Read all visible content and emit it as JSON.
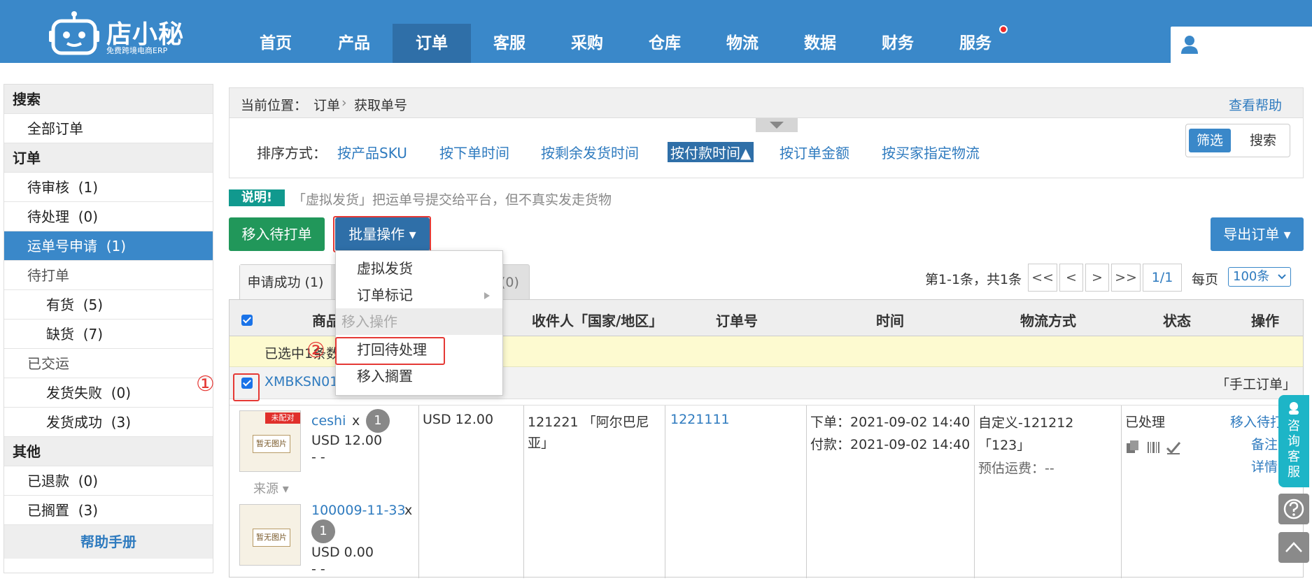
{
  "brand": {
    "name": "店小秘",
    "tagline": "免费跨境电商ERP"
  },
  "nav": {
    "items": [
      {
        "label": "首页"
      },
      {
        "label": "产品"
      },
      {
        "label": "订单"
      },
      {
        "label": "客服"
      },
      {
        "label": "采购"
      },
      {
        "label": "仓库"
      },
      {
        "label": "物流"
      },
      {
        "label": "数据"
      },
      {
        "label": "财务"
      },
      {
        "label": "服务"
      }
    ],
    "active": "订单"
  },
  "sidebar": {
    "search_head": "搜索",
    "all_orders": "全部订单",
    "order_head": "订单",
    "items": [
      {
        "label": "待审核",
        "count": "(1)"
      },
      {
        "label": "待处理",
        "count": "(0)"
      },
      {
        "label": "运单号申请",
        "count": "(1)"
      },
      {
        "label": "待打单",
        "count": ""
      },
      {
        "label": "有货",
        "count": "(5)"
      },
      {
        "label": "缺货",
        "count": "(7)"
      },
      {
        "label": "已交运",
        "count": ""
      },
      {
        "label": "发货失败",
        "count": "(0)"
      },
      {
        "label": "发货成功",
        "count": "(3)"
      }
    ],
    "other_head": "其他",
    "other": [
      {
        "label": "已退款",
        "count": "(0)"
      },
      {
        "label": "已搁置",
        "count": "(3)"
      }
    ],
    "help": "帮助手册"
  },
  "breadcrumb": {
    "prefix": "当前位置：",
    "level1": "订单",
    "sep": "›",
    "level2": "获取单号",
    "help_link": "查看帮助"
  },
  "sort": {
    "label": "排序方式：",
    "options": [
      "按产品SKU",
      "按下单时间",
      "按剩余发货时间",
      "按付款时间▲",
      "按订单金额",
      "按买家指定物流"
    ],
    "filter_btn": "筛选",
    "search_btn": "搜索"
  },
  "note": {
    "tag": "说明!",
    "text": "「虚拟发货」把运单号提交给平台，但不真实发走货物"
  },
  "actions": {
    "move_to_print": "移入待打单",
    "batch": "批量操作 ▾",
    "export": "导出订单 ▾"
  },
  "tabs": {
    "success": "申请成功 (1)",
    "other_count": "(0)"
  },
  "pager": {
    "range": "第1-1条，共1条",
    "first": "<<",
    "prev": "<",
    "next": ">",
    "last": ">>",
    "page": "1/1",
    "per_page_label": "每页",
    "per_page": "100条"
  },
  "dropdown": {
    "items": [
      {
        "label": "虚拟发货"
      },
      {
        "label": "订单标记"
      },
      {
        "label": "移入操作"
      },
      {
        "label": "打回待处理"
      },
      {
        "label": "移入搁置"
      }
    ]
  },
  "table": {
    "headers": {
      "product": "商品",
      "recipient": "收件人「国家/地区」",
      "order_no": "订单号",
      "time": "时间",
      "logistics": "物流方式",
      "status": "状态",
      "ops": "操作"
    },
    "selected_notice": "已选中1条数",
    "order_id": "XMBKSN01",
    "order_type": "「手工订单」",
    "unmatched_tag": "未配对",
    "no_image": "暂无图片",
    "source": "来源 ▾",
    "products": [
      {
        "name": "ceshi",
        "qty": "1",
        "price": "USD 12.00",
        "extra": "- -"
      },
      {
        "name": "100009-11-33",
        "qty": "1",
        "price": "USD 0.00",
        "extra": "- -"
      }
    ],
    "amount": "USD 12.00",
    "recipient": "121221 「阿尔巴尼亚」",
    "order_no": "1221111",
    "order_time": "下单：2021-09-02 14:40",
    "pay_time": "付款：2021-09-02 14:40",
    "logistics": "自定义-121212「123」",
    "freight": "预估运费：--",
    "status": "已处理",
    "ops": [
      "移入待打",
      "备注",
      "详情"
    ]
  },
  "annotations": {
    "one": "①",
    "two": "②"
  },
  "float": {
    "service": "咨询客服"
  },
  "colors": {
    "primary": "#3a88c9",
    "dark_primary": "#2f6fa8",
    "green": "#21975a",
    "red_mark": "#e53935",
    "teal": "#1db5c7"
  }
}
